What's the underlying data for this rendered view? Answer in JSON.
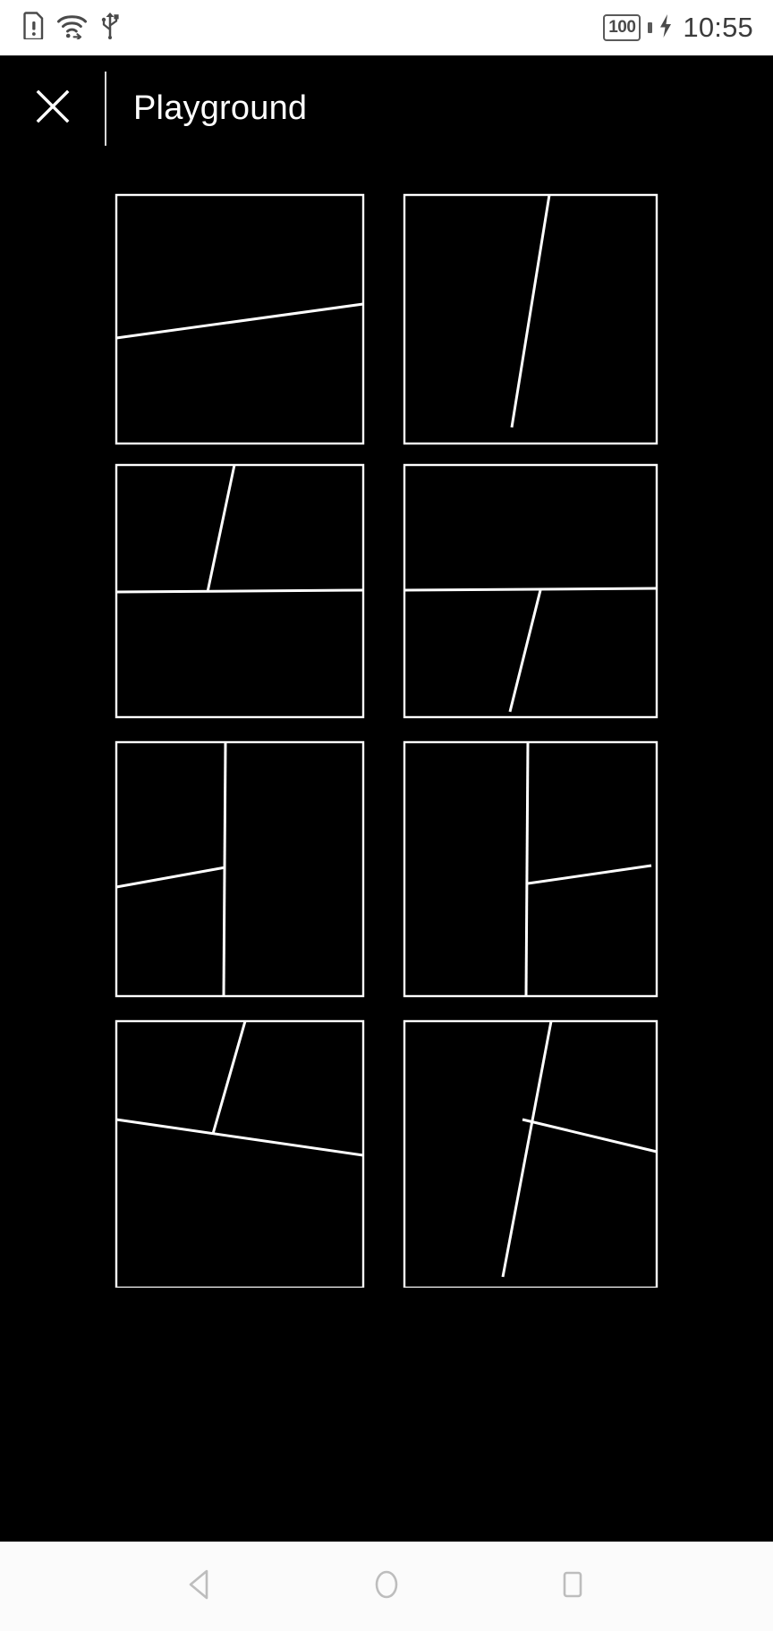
{
  "status_bar": {
    "icons": [
      "sim-alert-icon",
      "wifi-icon",
      "usb-icon"
    ],
    "battery_level": "100",
    "charging_icon": "charging-bolt-icon",
    "time": "10:55",
    "background_color": "#ffffff",
    "foreground_color": "#4a4a4a"
  },
  "toolbar": {
    "close_label": "×",
    "close_icon": "close-x-icon",
    "title": "Playground",
    "background_color": "#000000",
    "text_color": "#ffffff"
  },
  "canvas": {
    "background_color": "#000000",
    "stroke_color": "#ffffff",
    "stroke_width": 2.4,
    "columns": 2,
    "rows": 4,
    "tile_size": 310
  },
  "tiles": [
    {
      "id": "tile-1",
      "name": "single-slanted-line-in-frame",
      "frame": [
        20,
        18,
        276,
        278
      ],
      "lines": [
        [
          20,
          178,
          296,
          140
        ]
      ]
    },
    {
      "id": "tile-2",
      "name": "steep-diagonal-line-in-frame",
      "frame": [
        8,
        18,
        282,
        278
      ],
      "lines": [
        [
          170,
          18,
          128,
          278
        ]
      ]
    },
    {
      "id": "tile-3",
      "name": "horizontal-divider-with-upper-diagonal",
      "frame": [
        20,
        10,
        276,
        282
      ],
      "lines": [
        [
          20,
          152,
          296,
          150
        ],
        [
          152,
          10,
          122,
          152
        ]
      ]
    },
    {
      "id": "tile-4",
      "name": "horizontal-divider-with-lower-diagonal",
      "frame": [
        8,
        10,
        282,
        282
      ],
      "lines": [
        [
          8,
          150,
          290,
          148
        ],
        [
          160,
          150,
          126,
          286
        ]
      ]
    },
    {
      "id": "tile-5",
      "name": "vertical-divider-with-left-diagonal",
      "frame": [
        20,
        10,
        276,
        284
      ],
      "lines": [
        [
          142,
          10,
          140,
          294
        ],
        [
          20,
          172,
          142,
          150
        ]
      ]
    },
    {
      "id": "tile-6",
      "name": "vertical-divider-with-right-diagonal",
      "frame": [
        8,
        10,
        282,
        284
      ],
      "lines": [
        [
          146,
          10,
          144,
          294
        ],
        [
          146,
          168,
          284,
          148
        ]
      ]
    },
    {
      "id": "tile-7",
      "name": "crossing-diagonal-and-slanted-line",
      "frame": [
        20,
        12,
        276,
        298
      ],
      "lines": [
        [
          164,
          12,
          128,
          138
        ],
        [
          20,
          122,
          296,
          162
        ]
      ]
    },
    {
      "id": "tile-8",
      "name": "steep-diagonal-crossing-slanted-line",
      "frame": [
        8,
        12,
        282,
        298
      ],
      "lines": [
        [
          172,
          12,
          118,
          298
        ],
        [
          140,
          122,
          290,
          158
        ]
      ]
    }
  ],
  "nav_bar": {
    "background_color": "#fbfbfb",
    "icon_color": "#bdbdbd",
    "buttons": [
      {
        "name": "back-button",
        "icon": "back-triangle-icon"
      },
      {
        "name": "home-button",
        "icon": "home-circle-icon"
      },
      {
        "name": "recents-button",
        "icon": "recents-square-icon"
      }
    ]
  }
}
